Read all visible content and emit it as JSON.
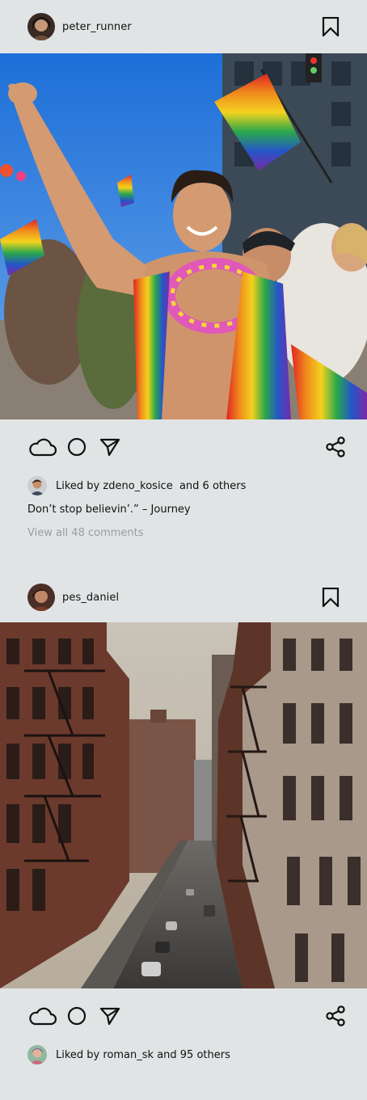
{
  "posts": [
    {
      "username": "peter_runner",
      "likes_text": "Liked by zdeno_kosice  and 6 others",
      "caption": "Don’t stop believin’.” – Journey",
      "comments_link": "View all 48 comments",
      "photo_description": "pride parade crowd with rainbow flags"
    },
    {
      "username": "pes_daniel",
      "likes_text": "Liked by roman_sk and 95 others",
      "photo_description": "city street between brick buildings with fire escapes"
    }
  ],
  "icons": {
    "like": "cloud-icon",
    "comment": "circle-icon",
    "send": "paper-plane-icon",
    "share": "share-icon",
    "save": "bookmark-icon"
  },
  "colors": {
    "background": "#e1e4e5",
    "text": "#111111",
    "muted": "#9a9d9f"
  }
}
